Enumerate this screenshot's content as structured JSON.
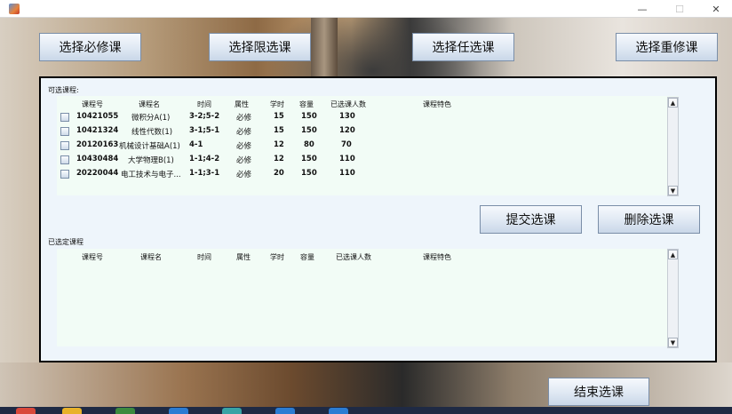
{
  "window": {
    "min_glyph": "—",
    "max_glyph": "☐",
    "close_glyph": "✕"
  },
  "top_buttons": {
    "required": "选择必修课",
    "limited": "选择限选课",
    "optional": "选择任选课",
    "retake": "选择重修课"
  },
  "available": {
    "label": "可选课程:",
    "headers": [
      "课程号",
      "课程名",
      "时间",
      "属性",
      "学时",
      "容量",
      "已选课人数",
      "课程特色"
    ],
    "rows": [
      {
        "id": "10421055",
        "name": "微积分A(1)",
        "time": "3-2;5-2",
        "attr": "必修",
        "hours": "15",
        "capacity": "150",
        "enrolled": "130"
      },
      {
        "id": "10421324",
        "name": "线性代数(1)",
        "time": "3-1;5-1",
        "attr": "必修",
        "hours": "15",
        "capacity": "150",
        "enrolled": "120"
      },
      {
        "id": "20120163",
        "name": "机械设计基础A(1)",
        "time": "4-1",
        "attr": "必修",
        "hours": "12",
        "capacity": "80",
        "enrolled": "70"
      },
      {
        "id": "10430484",
        "name": "大学物理B(1)",
        "time": "1-1;4-2",
        "attr": "必修",
        "hours": "12",
        "capacity": "150",
        "enrolled": "110"
      },
      {
        "id": "20220044",
        "name": "电工技术与电子...",
        "time": "1-1;3-1",
        "attr": "必修",
        "hours": "20",
        "capacity": "150",
        "enrolled": "110"
      }
    ]
  },
  "actions": {
    "submit": "提交选课",
    "delete": "删除选课",
    "end": "结束选课"
  },
  "selected": {
    "label": "已选定课程",
    "headers": [
      "课程号",
      "课程名",
      "时间",
      "属性",
      "学时",
      "容量",
      "已选课人数",
      "课程特色"
    ],
    "rows": []
  }
}
